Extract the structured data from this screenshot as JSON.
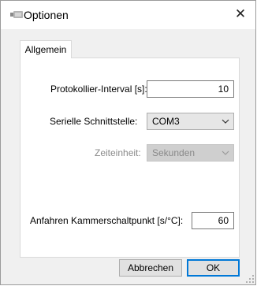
{
  "window": {
    "title": "Optionen",
    "close_symbol": "✕"
  },
  "tabs": [
    {
      "label": "Allgemein",
      "selected": true
    }
  ],
  "fields": {
    "protokollier_interval": {
      "label": "Protokollier-Interval [s]:",
      "value": "10"
    },
    "serielle_schnittstelle": {
      "label": "Serielle Schnittstelle:",
      "value": "COM3"
    },
    "zeiteinheit": {
      "label": "Zeiteinheit:",
      "value": "Sekunden",
      "enabled": false
    },
    "anfahren_kammerschaltpunkt": {
      "label": "Anfahren Kammerschaltpunkt [s/°C]:",
      "value": "60"
    }
  },
  "buttons": {
    "cancel": "Abbrechen",
    "ok": "OK"
  },
  "icons": {
    "app": "app-icon",
    "close": "close-icon",
    "dropdown": "chevron-down-icon",
    "resize": "resize-grip-icon"
  },
  "colors": {
    "window_bg": "#f0f0f0",
    "panel_bg": "#ffffff",
    "focus_border": "#0078d7",
    "disabled_text": "#8a8a8a"
  }
}
